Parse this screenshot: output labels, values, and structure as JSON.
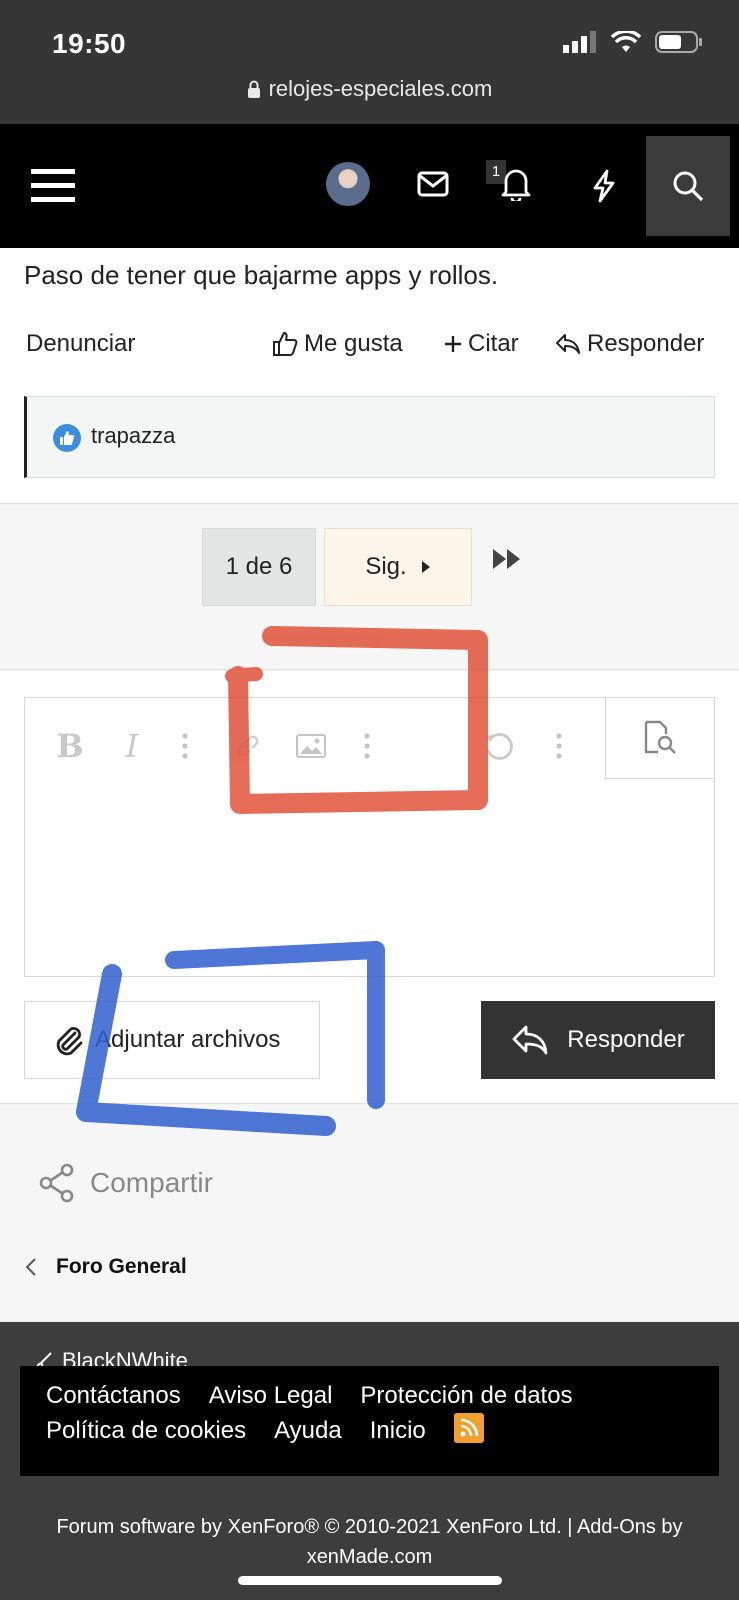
{
  "status_bar": {
    "time": "19:50",
    "url": "relojes-especiales.com"
  },
  "nav": {
    "notification_count": "1"
  },
  "post": {
    "text": "Paso de tener que bajarme apps y rollos.",
    "actions": {
      "report": "Denunciar",
      "like": "Me gusta",
      "quote": "Citar",
      "reply": "Responder"
    },
    "reactions": {
      "user": "trapazza"
    }
  },
  "pagination": {
    "current": "1 de 6",
    "next": "Sig."
  },
  "editor": {
    "toolbar": [
      "bold-icon",
      "italic-icon",
      "more-icon",
      "link-icon",
      "image-icon",
      "more-icon",
      "undo-icon",
      "more-icon",
      "preview-icon"
    ],
    "attach_label": "Adjuntar archivos",
    "reply_label": "Responder"
  },
  "share": {
    "label": "Compartir"
  },
  "breadcrumb": {
    "label": "Foro General"
  },
  "footer": {
    "style_chooser": "BlackNWhite",
    "links_row1": [
      "Contáctanos",
      "Aviso Legal",
      "Protección de datos"
    ],
    "links_row2": [
      "Política de cookies",
      "Ayuda",
      "Inicio"
    ],
    "copyright_line1": "Forum software by XenForo® © 2010-2021 XenForo Ltd. | Add-Ons by",
    "copyright_line2": "xenMade.com"
  },
  "annotations": {
    "red_color": "#e0523a",
    "blue_color": "#2f5fcf"
  }
}
